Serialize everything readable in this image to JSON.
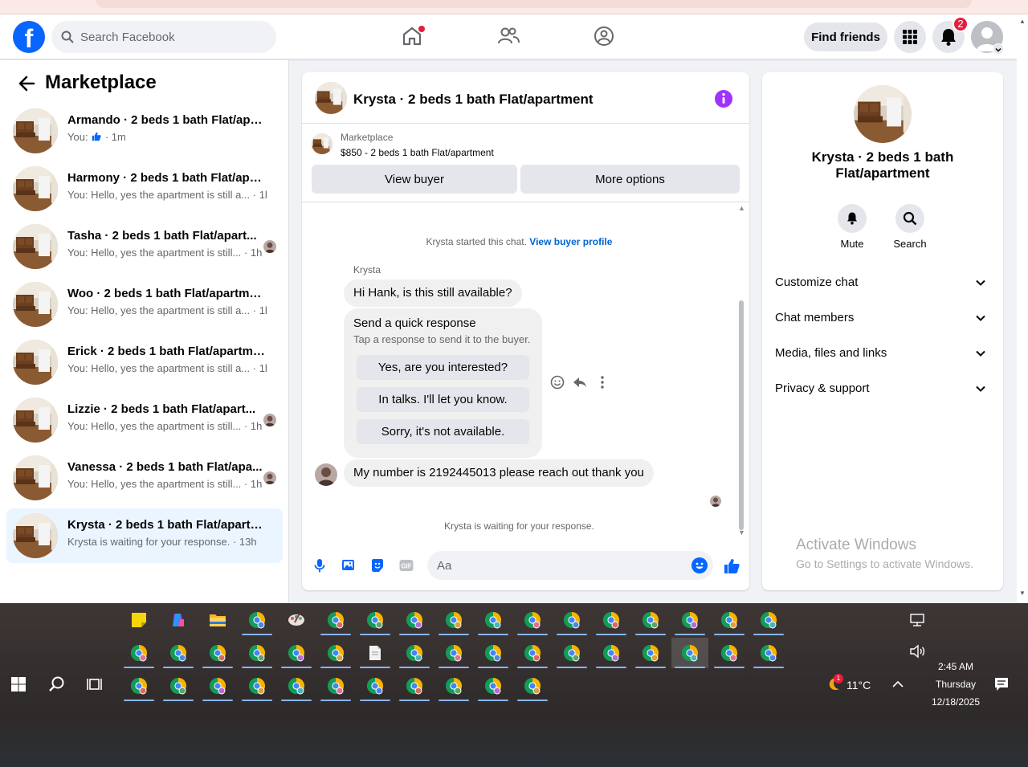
{
  "colors": {
    "brand": "#0866ff",
    "notify": "#e41e3f",
    "link": "#0064d1",
    "info": "#a033ff"
  },
  "nav": {
    "search_placeholder": "Search Facebook",
    "find_friends_label": "Find friends",
    "notifications_count": "2",
    "icons": [
      "facebook-logo",
      "search-icon",
      "home-icon",
      "friends-icon",
      "groups-icon",
      "menu-grid-icon",
      "bell-icon",
      "avatar"
    ]
  },
  "sidebar": {
    "title": "Marketplace",
    "conversations": [
      {
        "title": "Armando · 2 beds 1 bath Flat/apar...",
        "you": "You:",
        "preview": "",
        "time": "· 1m",
        "liked": true,
        "seen": false
      },
      {
        "title": "Harmony · 2 beds 1 bath Flat/apar...",
        "you": "",
        "preview": "You: Hello, yes the apartment is still a...",
        "time": "· 1h",
        "liked": false,
        "seen": false
      },
      {
        "title": "Tasha · 2 beds 1 bath Flat/apart...",
        "you": "",
        "preview": "You: Hello, yes the apartment is still...",
        "time": "· 1h",
        "liked": false,
        "seen": true
      },
      {
        "title": "Woo · 2 beds 1 bath Flat/apartment",
        "you": "",
        "preview": "You: Hello, yes the apartment is still a...",
        "time": "· 1h",
        "liked": false,
        "seen": false
      },
      {
        "title": "Erick · 2 beds 1 bath Flat/apartment",
        "you": "",
        "preview": "You: Hello, yes the apartment is still a...",
        "time": "· 1h",
        "liked": false,
        "seen": false
      },
      {
        "title": "Lizzie · 2 beds 1 bath Flat/apart...",
        "you": "",
        "preview": "You: Hello, yes the apartment is still...",
        "time": "· 1h",
        "liked": false,
        "seen": true
      },
      {
        "title": "Vanessa · 2 beds 1 bath Flat/apa...",
        "you": "",
        "preview": "You: Hello, yes the apartment is still...",
        "time": "· 1h",
        "liked": false,
        "seen": true
      },
      {
        "title": "Krysta · 2 beds 1 bath Flat/apartm...",
        "you": "",
        "preview": "Krysta is waiting for your response.",
        "time": "· 13h",
        "liked": false,
        "seen": false,
        "active": true
      }
    ]
  },
  "chat": {
    "title": "Krysta · 2 beds 1 bath Flat/apartment",
    "listing_source": "Marketplace",
    "listing_price": "$850 - 2 beds 1 bath Flat/apartment",
    "view_buyer_label": "View buyer",
    "more_options_label": "More options",
    "started_text": "Krysta started this chat.",
    "view_profile_link": "View buyer profile",
    "sender_name": "Krysta",
    "message_1": "Hi Hank, is this still available?",
    "quick_title": "Send a quick response",
    "quick_sub": "Tap a response to send it to the buyer.",
    "quick_replies": [
      "Yes, are you interested?",
      "In talks. I'll let you know.",
      "Sorry, it's not available."
    ],
    "message_2": "My number is 2192445013 please reach out thank you",
    "waiting_text": "Krysta is waiting for your response.",
    "composer_placeholder": "Aa"
  },
  "details": {
    "title": "Krysta · 2 beds 1 bath Flat/apartment",
    "mute_label": "Mute",
    "search_label": "Search",
    "sections": [
      "Customize chat",
      "Chat members",
      "Media, files and links",
      "Privacy & support"
    ],
    "watermark_1": "Activate Windows",
    "watermark_2": "Go to Settings to activate Windows."
  },
  "taskbar": {
    "weather": "11°C",
    "weather_badge": "1",
    "time": "2:45 AM",
    "day": "Thursday",
    "date": "12/18/2025"
  }
}
